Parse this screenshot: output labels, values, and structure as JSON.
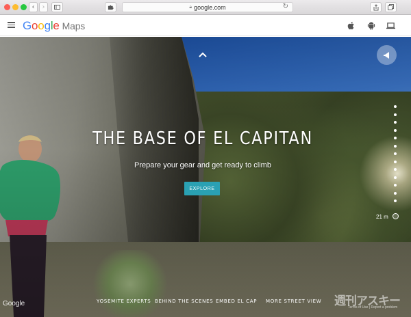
{
  "browser": {
    "url": "google.com",
    "back_glyph": "‹",
    "forward_glyph": "›",
    "reload_glyph": "↻",
    "colors": {
      "close": "#fc5f57",
      "minimize": "#fdbc2f",
      "zoom": "#28c840"
    }
  },
  "header": {
    "logo_letters": [
      {
        "ch": "G",
        "color": "#4285f4"
      },
      {
        "ch": "o",
        "color": "#ea4335"
      },
      {
        "ch": "o",
        "color": "#fbbc05"
      },
      {
        "ch": "g",
        "color": "#4285f4"
      },
      {
        "ch": "l",
        "color": "#34a853"
      },
      {
        "ch": "e",
        "color": "#ea4335"
      }
    ],
    "product": "Maps",
    "icons": [
      "apple-icon",
      "android-icon",
      "laptop-icon"
    ]
  },
  "hero": {
    "title": "THE BASE OF EL CAPITAN",
    "subtitle": "Prepare your gear and get ready to climb",
    "explore_label": "EXPLORE",
    "distance": "21 m"
  },
  "footer_links": [
    "YOSEMITE EXPERTS",
    "BEHIND THE SCENES",
    "EMBED EL CAP",
    "MORE STREET VIEW"
  ],
  "google_logo": "Google",
  "watermark": "週刊アスキー",
  "terms": "Terms of Use | Report a problem"
}
